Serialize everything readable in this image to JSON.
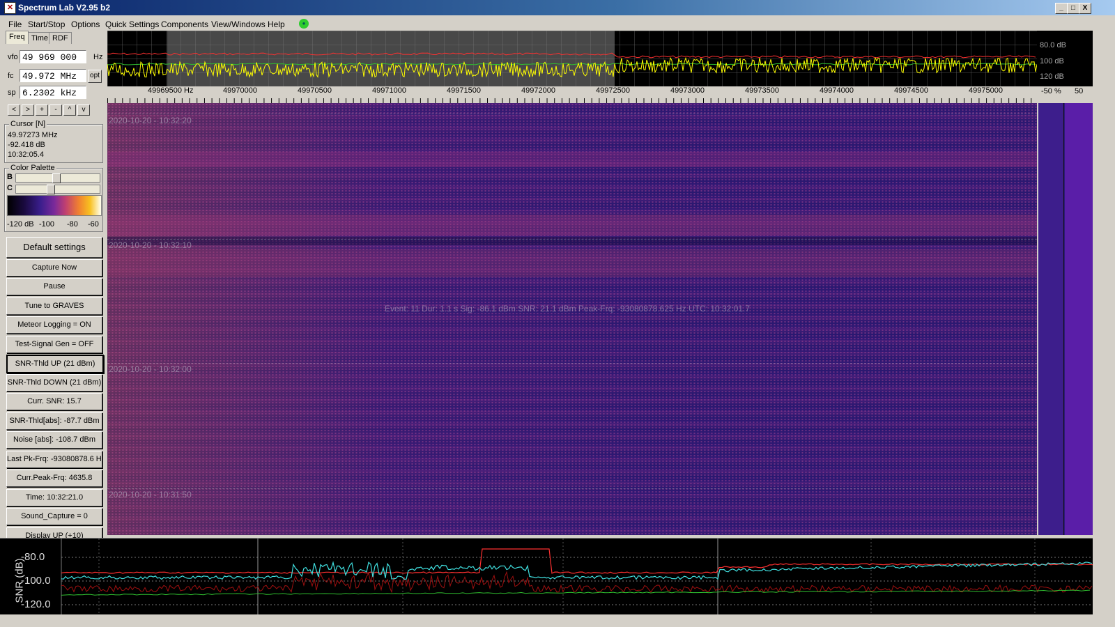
{
  "window": {
    "title": "Spectrum Lab V2.95 b2",
    "min": "_",
    "max": "□",
    "close": "X",
    "app_icon": "SL"
  },
  "menu": [
    "File",
    "Start/Stop",
    "Options",
    "Quick Settings",
    "Components",
    "View/Windows",
    "Help"
  ],
  "status_dot": "ok",
  "tabs": [
    "Freq",
    "Time",
    "RDF"
  ],
  "freq_controls": {
    "vfo_label": "vfo",
    "vfo_value": "49 969 000",
    "vfo_unit": "Hz",
    "fc_label": "fc",
    "fc_value": "49.972 MHz",
    "fc_btn": "opt",
    "sp_label": "sp",
    "sp_value": "6.2302 kHz",
    "nav_buttons": [
      "<",
      ">",
      "+",
      "-",
      "^",
      "v"
    ]
  },
  "cursor": {
    "title": "Cursor [N]",
    "freq": "49.97273 MHz",
    "level": "-92.418 dB",
    "time": "10:32:05.4"
  },
  "palette": {
    "title": "Color Palette",
    "b_label": "B",
    "c_label": "C",
    "labels": [
      "-120 dB",
      "-100",
      "-80",
      "-60"
    ]
  },
  "buttons": [
    "Default settings",
    "Capture Now",
    "Pause",
    "Tune to GRAVES",
    "Meteor Logging = ON",
    "Test-Signal Gen = OFF",
    "SNR-Thld UP (21 dBm)",
    "SNR-Thld DOWN (21 dBm)",
    "Curr. SNR: 15.7",
    "SNR-Thld[abs]: -87.7 dBm",
    "Noise [abs]: -108.7 dBm",
    "Last Pk-Frq: -93080878.6 Hz",
    "Curr.Peak-Frq: 4635.8",
    "Time:  10:32:21.0",
    "Sound_Capture = 0",
    "Display UP (+10)"
  ],
  "spectrum_scale": [
    "80.0 dB",
    "100 dB",
    "120 dB"
  ],
  "freq_axis": [
    "49969500 Hz",
    "49970000",
    "49970500",
    "49971000",
    "49971500",
    "49972000",
    "49972500",
    "49973000",
    "49973500",
    "49974000",
    "49974500",
    "49975000"
  ],
  "pct_axis": [
    "-50 %",
    "50"
  ],
  "waterfall": {
    "time_labels": [
      "2020-10-20 - 10:32:20",
      "2020-10-20 - 10:32:10",
      "2020-10-20 - 10:32:00",
      "2020-10-20 - 10:31:50"
    ],
    "event_text": "Event: 11   Dur: 1.1 s   Sig: -86.1 dBm   SNR: 21.1 dBm   Peak-Frq: -93080878.625 Hz   UTC: 10:32:01.7"
  },
  "snr_plot": {
    "ylabel": "SNR (dB)",
    "ticks": [
      "-80.0",
      "-100.0",
      "-120.0"
    ]
  },
  "colors": {
    "trace_yellow": "#ffff00",
    "trace_red": "#ff3030",
    "trace_cyan": "#40e0e0",
    "trace_green": "#30c030"
  }
}
